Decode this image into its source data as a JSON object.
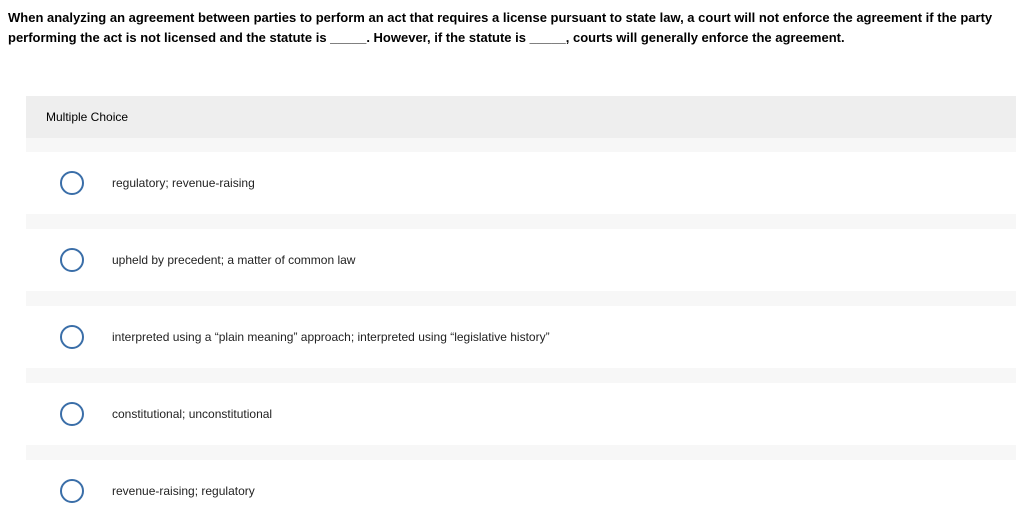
{
  "question": "When analyzing an agreement between parties to perform an act that requires a license pursuant to state law, a court will not enforce the agreement if the party performing the act is not licensed and the statute is _____. However, if the statute is _____, courts will generally enforce the agreement.",
  "section_label": "Multiple Choice",
  "options": [
    {
      "label": "regulatory; revenue-raising"
    },
    {
      "label": "upheld by precedent; a matter of common law"
    },
    {
      "label": "interpreted using a “plain meaning” approach; interpreted using “legislative history”"
    },
    {
      "label": "constitutional; unconstitutional"
    },
    {
      "label": "revenue-raising; regulatory"
    }
  ]
}
